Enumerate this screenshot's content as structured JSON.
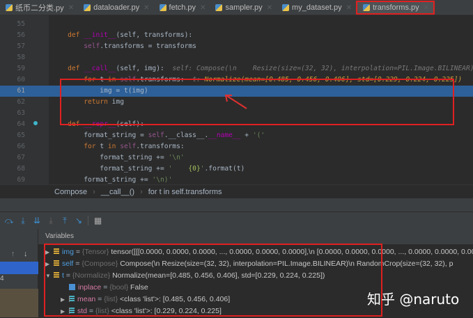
{
  "tabs": [
    {
      "label": "纸币二分类.py"
    },
    {
      "label": "dataloader.py"
    },
    {
      "label": "fetch.py"
    },
    {
      "label": "sampler.py"
    },
    {
      "label": "my_dataset.py"
    },
    {
      "label": "transforms.py",
      "active": true
    }
  ],
  "code": [
    {
      "n": "55",
      "t": []
    },
    {
      "n": "56",
      "t": [
        [
          "    ",
          "tx"
        ],
        [
          "def ",
          "kw"
        ],
        [
          "__init__",
          "fn"
        ],
        [
          "(self, transforms):",
          "tx"
        ]
      ]
    },
    {
      "n": "57",
      "t": [
        [
          "        ",
          "tx"
        ],
        [
          "self",
          "sf"
        ],
        [
          ".transforms = transforms",
          "tx"
        ]
      ]
    },
    {
      "n": "58",
      "t": []
    },
    {
      "n": "59",
      "t": [
        [
          "    ",
          "tx"
        ],
        [
          "def ",
          "kw"
        ],
        [
          "__call__",
          "fn"
        ],
        [
          "(self, img):  ",
          "tx"
        ],
        [
          "self: Compose(\\n    Resize(size=(32, 32), interpolation=PIL.Image.BILINEAR)\\n",
          "hint"
        ]
      ]
    },
    {
      "n": "60",
      "t": [
        [
          "        ",
          "tx"
        ],
        [
          "for ",
          "kw"
        ],
        [
          "t ",
          "tx"
        ],
        [
          "in ",
          "kw"
        ],
        [
          "self",
          "sf"
        ],
        [
          ".transforms:  ",
          "tx"
        ],
        [
          "t: ",
          "hint"
        ],
        [
          "Normalize(mean=[0.485, 0.456, 0.406], std=[0.229, 0.224, 0.225])",
          "hv"
        ]
      ]
    },
    {
      "n": "61",
      "t": [
        [
          "            img = t(img)",
          "tx"
        ]
      ],
      "current": true
    },
    {
      "n": "62",
      "t": [
        [
          "        ",
          "tx"
        ],
        [
          "return ",
          "kw"
        ],
        [
          "img",
          "tx"
        ]
      ]
    },
    {
      "n": "63",
      "t": []
    },
    {
      "n": "64",
      "t": [
        [
          "    ",
          "tx"
        ],
        [
          "def ",
          "kw"
        ],
        [
          "__repr__",
          "fn"
        ],
        [
          "(self):",
          "tx"
        ]
      ]
    },
    {
      "n": "65",
      "t": [
        [
          "        format_string = ",
          "tx"
        ],
        [
          "self",
          "sf"
        ],
        [
          ".__class__.",
          "tx"
        ],
        [
          "__name__",
          "fn"
        ],
        [
          " + ",
          "tx"
        ],
        [
          "'('",
          "st"
        ]
      ]
    },
    {
      "n": "66",
      "t": [
        [
          "        ",
          "tx"
        ],
        [
          "for ",
          "kw"
        ],
        [
          "t ",
          "tx"
        ],
        [
          "in ",
          "kw"
        ],
        [
          "self",
          "sf"
        ],
        [
          ".transforms:",
          "tx"
        ]
      ]
    },
    {
      "n": "67",
      "t": [
        [
          "            format_string += ",
          "tx"
        ],
        [
          "'\\n'",
          "st"
        ]
      ]
    },
    {
      "n": "68",
      "t": [
        [
          "            format_string += ",
          "tx"
        ],
        [
          "'    ",
          "st"
        ],
        [
          "{0}",
          "br"
        ],
        [
          "'",
          "st"
        ],
        [
          ".format(t)",
          "tx"
        ]
      ]
    },
    {
      "n": "69",
      "t": [
        [
          "        format_string += ",
          "tx"
        ],
        [
          "'\\n)'",
          "st"
        ]
      ]
    }
  ],
  "breadcrumb": [
    "Compose",
    "__call__()",
    "for t in self.transforms"
  ],
  "frames": {
    "line_fragment": "4"
  },
  "variables": {
    "title": "Variables",
    "rows": [
      {
        "exp": "▶",
        "icon": "field",
        "name": "img",
        "type": "{Tensor}",
        "value": "tensor([[[0.0000, 0.0000, 0.0000,  ..., 0.0000, 0.0000, 0.0000],\\n",
        "value2": "        [0.0000, 0.0000, 0.0000,  ..., 0.0000, 0.0000, 0.000"
      },
      {
        "exp": "▶",
        "icon": "field",
        "name": "self",
        "type": "{Compose}",
        "value": "Compose(\\n    Resize(size=(32, 32), interpolation=PIL.Image.BILINEAR)\\n    RandomCrop(size=(32, 32), p"
      },
      {
        "exp": "▼",
        "icon": "field",
        "name": "t",
        "type": "{Normalize}",
        "value": "Normalize(mean=[0.485, 0.456, 0.406], std=[0.229, 0.224, 0.225])"
      },
      {
        "exp": "",
        "icon": "bool",
        "name": "inplace",
        "type": "{bool}",
        "value": "False"
      },
      {
        "exp": "▶",
        "icon": "list",
        "name": "mean",
        "type": "{list}",
        "value": "<class 'list'>: [0.485, 0.456, 0.406]"
      },
      {
        "exp": "▶",
        "icon": "list",
        "name": "std",
        "type": "{list}",
        "value": "<class 'list'>: [0.229, 0.224, 0.225]"
      }
    ]
  },
  "watermark": "知乎 @naruto"
}
